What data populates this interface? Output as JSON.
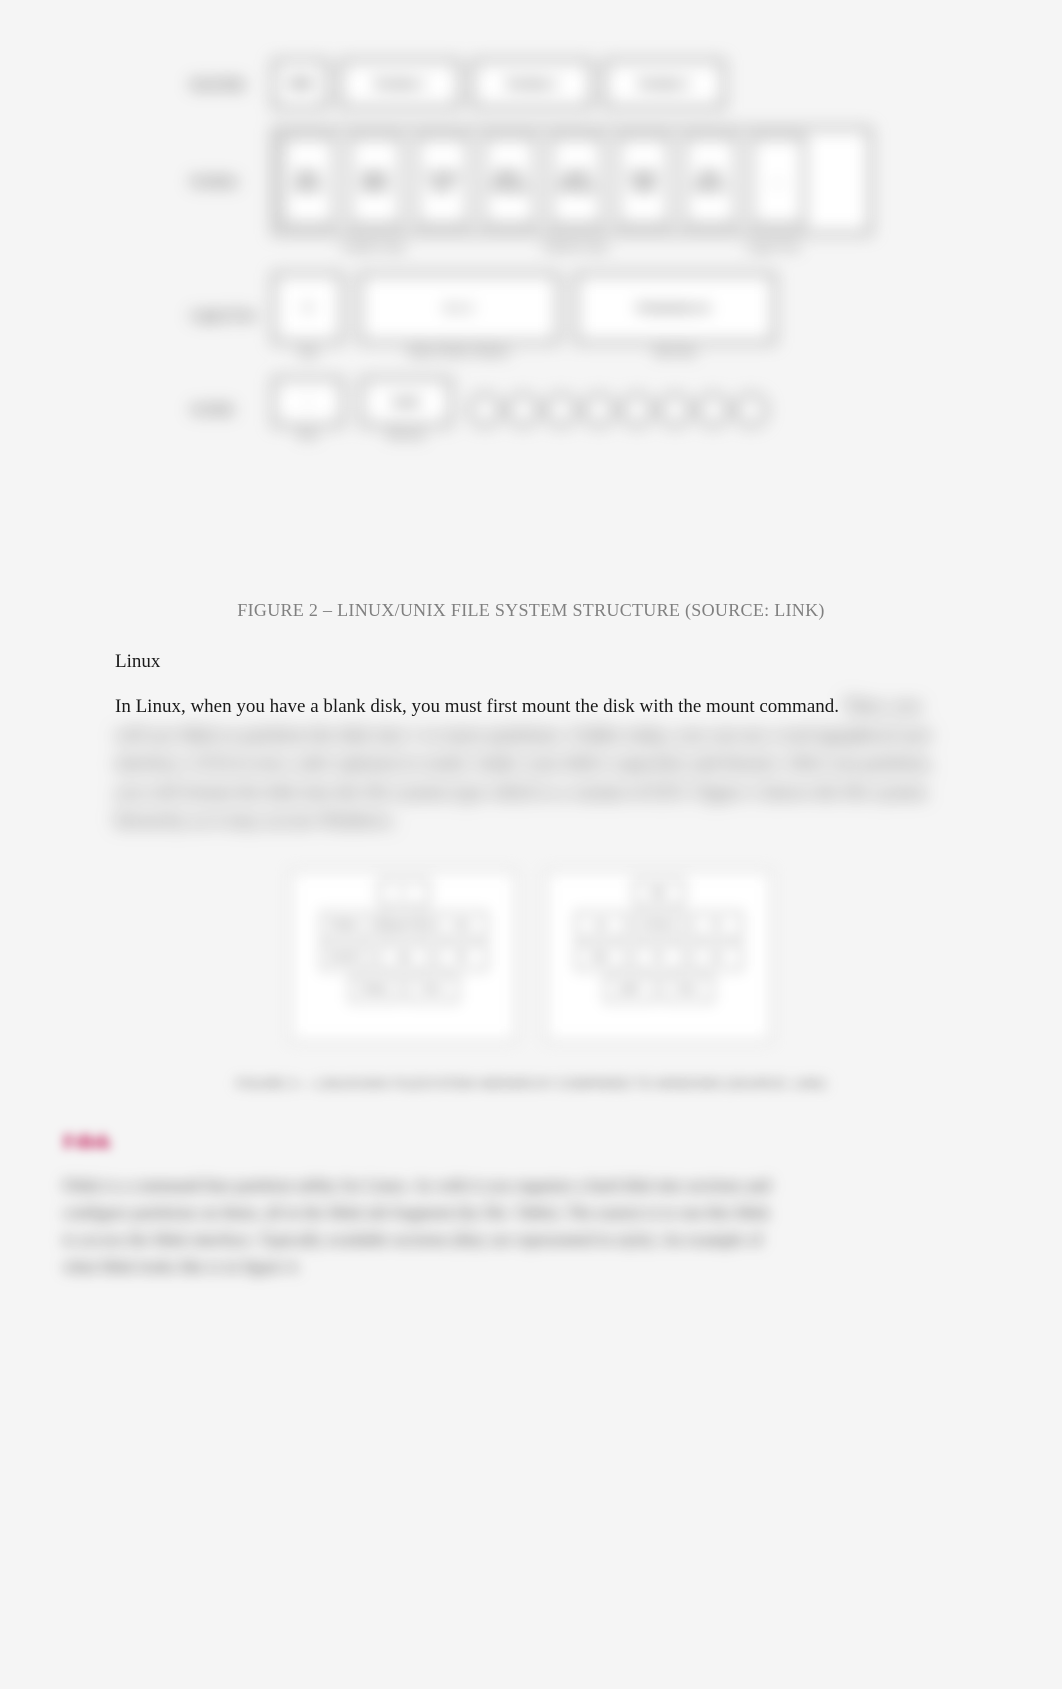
{
  "figure2": {
    "caption": "FIGURE 2 – LINUX/UNIX FILE SYSTEM STRUCTURE (SOURCE: LINK)",
    "rows": {
      "row1_label": "Hard Disk",
      "row1_boxes": [
        "MBR",
        "Partition 1",
        "Partition 2",
        "Partition 3"
      ],
      "row2_label": "Partition",
      "row2_boxes": [
        "Boot Block",
        "Super Block",
        "Group Desc",
        "Block Bitmap",
        "Inode Bitmap",
        "Inode Table",
        "Data Blocks",
        "..."
      ],
      "row2_sub_labels": [
        "Cylinder Group",
        "Partition Group",
        "Logical View"
      ],
      "row3_label": "Logical View",
      "row3_boxes": [
        "0",
        "0, 1, 2",
        "Permissions etc."
      ],
      "row3_sub_labels": [
        "Type",
        "Major & Minor Numbers",
        "Meta Data"
      ],
      "row4_label": "On Disk",
      "row4_boxes": [
        "/",
        "Inode"
      ],
      "row4_sub_labels": [
        "Root",
        "Directory"
      ],
      "row4_circles": [
        "○",
        "○",
        "○",
        "○",
        "○",
        "○",
        "○",
        "○"
      ]
    }
  },
  "content": {
    "linux_heading": "Linux",
    "linux_paragraph_visible": "In Linux, when you have a blank disk, you must first mount the disk with the mount command.",
    "linux_paragraph_locked": "Then, you will use fdisk to partition the disk into 1 or more partitions. Unlike today, you can use a tool (graphical user interface, GUI) in new, safer options) to easily 'study' your disk's capacities and dossier. After you partition, you will format the disk into the file system type which is a variant of EXT. Figure 3 shows the file system hierarchy as it may accrue Windows."
  },
  "figure3": {
    "tree_a_root": "C:",
    "tree_a_boxes": [
      "Windows",
      "Program Files",
      "Users",
      "System32",
      "App",
      "Me",
      "Desktop",
      "file.txt"
    ],
    "tree_b_root": "Sda1",
    "tree_b_boxes": [
      "root",
      "etc/bin/usr",
      "lib",
      "home",
      "bin",
      "user",
      "profile",
      "file.txt"
    ],
    "caption": "FIGURE 3 — LINUX/UNIX FILESYSTEM HIERARCHY COMPARED TO WINDOWS (SOURCE: LINK)"
  },
  "fdisk_section": {
    "heading": "Fdisk",
    "paragraph": "Fdisk is a command-line partition utility for Linux. As with it you organize a hard disk into sections and configure partitions on them, all in the fdisk tab fragment (by file. Table). The easiest is to run this fdisk to access the fdisk interface. Typically available sections (they are represented in style). An example of what fdisk looks like is in figure 4."
  }
}
